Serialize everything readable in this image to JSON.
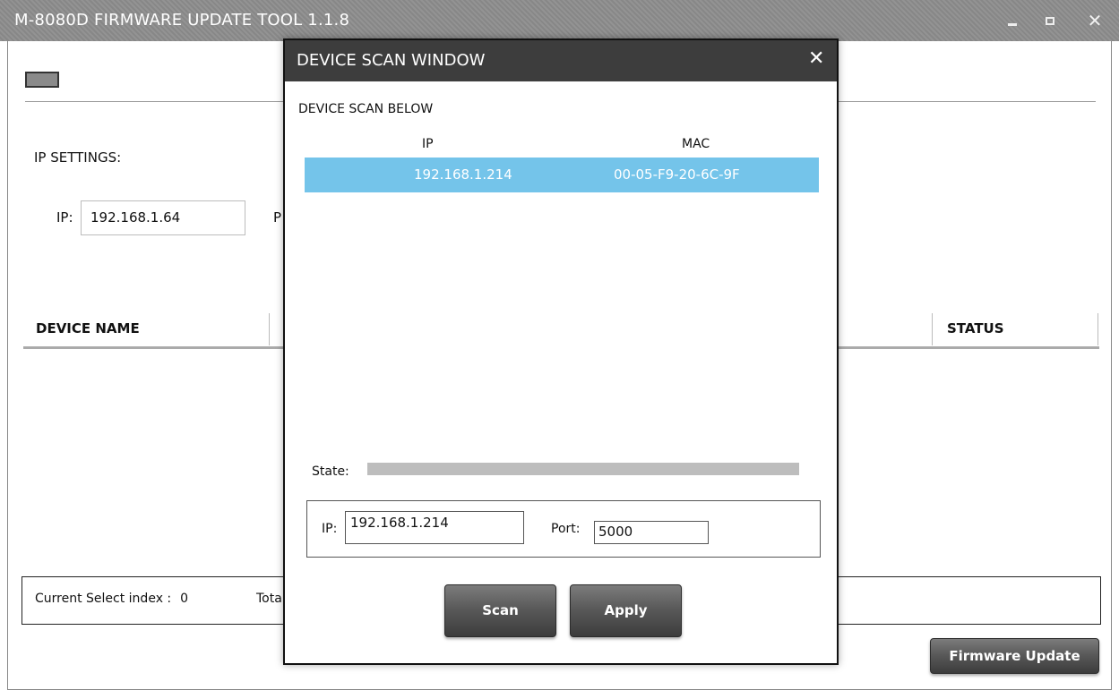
{
  "app": {
    "title": "M-8080D FIRMWARE UPDATE TOOL 1.1.8",
    "ip_settings_label": "IP SETTINGS:",
    "ip_label": "IP:",
    "ip_value": "192.168.1.64",
    "port_label_clipped": "P",
    "columns": {
      "device_name": "DEVICE NAME",
      "status": "STATUS"
    },
    "status_bar": {
      "current_select_label": "Current Select index :",
      "current_select_value": "0",
      "total_label_clipped": "Tota"
    },
    "firmware_update_button": "Firmware Update",
    "window_controls": {
      "close": "✕"
    }
  },
  "dialog": {
    "title": "DEVICE SCAN WINDOW",
    "close_glyph": "✕",
    "subtitle": "DEVICE SCAN BELOW",
    "table": {
      "headers": {
        "ip": "IP",
        "mac": "MAC"
      },
      "rows": [
        {
          "ip": "192.168.1.214",
          "mac": "00-05-F9-20-6C-9F",
          "selected": true
        }
      ]
    },
    "state_label": "State:",
    "state_progress": 0,
    "ip_label": "IP:",
    "ip_value": "192.168.1.214",
    "port_label": "Port:",
    "port_value": "5000",
    "scan_button": "Scan",
    "apply_button": "Apply"
  },
  "colors": {
    "titlebar": "#8c8c8c",
    "dialog_titlebar": "#3d3d3d",
    "selected_row": "#74c4ea",
    "state_bar": "#bdbdbd"
  },
  "icons": {
    "minimize": "minimize-icon",
    "maximize": "maximize-icon",
    "close": "close-icon"
  }
}
